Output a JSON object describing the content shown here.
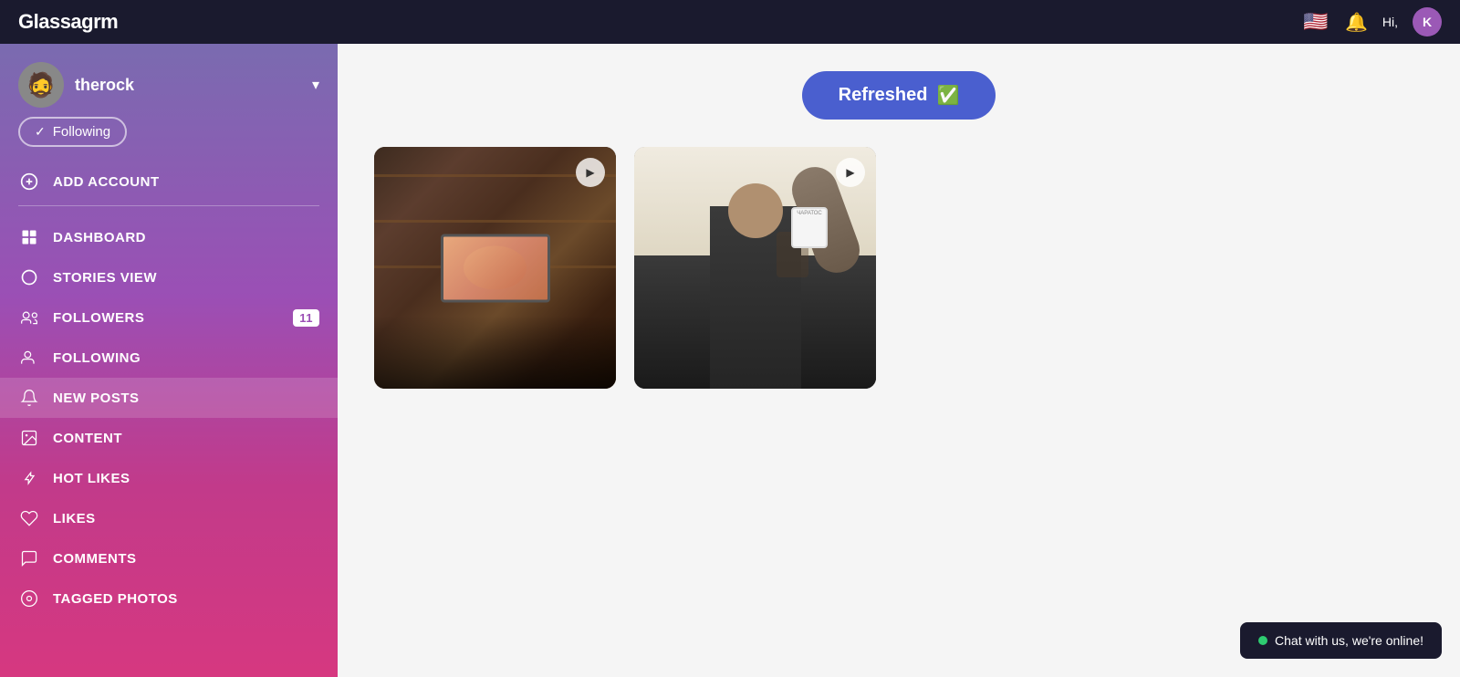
{
  "navbar": {
    "brand": "Glassagrm",
    "brand_normal": "Glassa",
    "brand_italic": "grm",
    "hi_text": "Hi,",
    "user_initial": "K",
    "flag_emoji": "🇺🇸"
  },
  "sidebar": {
    "profile": {
      "username": "therock",
      "avatar_emoji": "🧔"
    },
    "following_label": "Following",
    "add_account_label": "ADD ACCOUNT",
    "menu_items": [
      {
        "id": "dashboard",
        "label": "DASHBOARD",
        "icon": "dashboard"
      },
      {
        "id": "stories-view",
        "label": "STORIES VIEW",
        "icon": "circle"
      },
      {
        "id": "followers",
        "label": "FOLLOWERS",
        "icon": "person-badge",
        "badge": "11"
      },
      {
        "id": "following",
        "label": "FOLLOWING",
        "icon": "person"
      },
      {
        "id": "new-posts",
        "label": "NEW POSTS",
        "icon": "bell",
        "active": true
      },
      {
        "id": "content",
        "label": "CONTENT",
        "icon": "image"
      },
      {
        "id": "hot-likes",
        "label": "HOT LIKES",
        "icon": "thumbs-up"
      },
      {
        "id": "likes",
        "label": "LIKES",
        "icon": "heart"
      },
      {
        "id": "comments",
        "label": "COMMENTS",
        "icon": "comment"
      },
      {
        "id": "tagged-photos",
        "label": "TAGGED PHOTOS",
        "icon": "tag"
      }
    ]
  },
  "content": {
    "refresh_button_label": "Refreshed",
    "refresh_check": "✅"
  },
  "chat_widget": {
    "label": "Chat with us, we're online!"
  }
}
